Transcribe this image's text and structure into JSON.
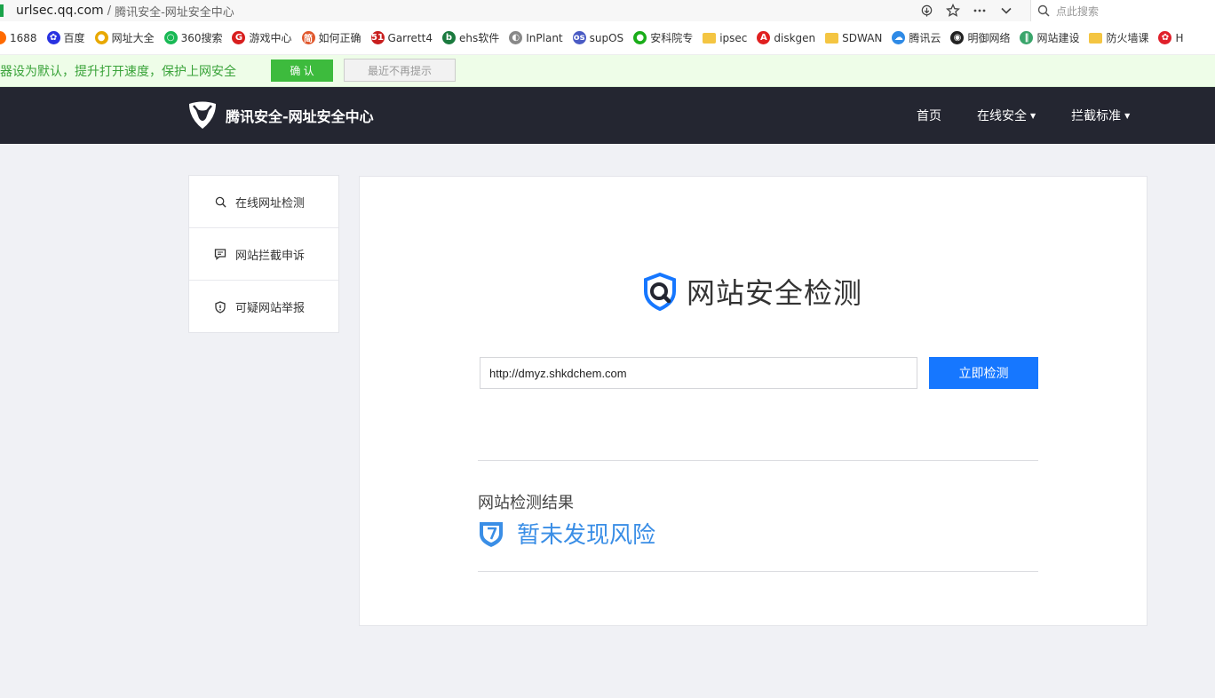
{
  "browser": {
    "url_host": "urlsec.qq.com",
    "url_sep": "/",
    "page_title": "腾讯安全-网址安全中心",
    "search_placeholder": "点此搜索"
  },
  "bookmarks": [
    {
      "label": "1688",
      "icon": "1688-icon",
      "color": "#ff6a00"
    },
    {
      "label": "百度",
      "icon": "baidu-paw-icon",
      "color": "#2932e1"
    },
    {
      "label": "网址大全",
      "icon": "hao123-icon",
      "color": "#e8a800"
    },
    {
      "label": "360搜索",
      "icon": "360-icon",
      "color": "#19b955"
    },
    {
      "label": "游戏中心",
      "icon": "game-icon",
      "color": "#d81e1e"
    },
    {
      "label": "如何正确",
      "icon": "jian-icon",
      "color": "#e0572c"
    },
    {
      "label": "Garrett4",
      "icon": "51-icon",
      "color": "#c81e1e"
    },
    {
      "label": "ehs软件",
      "icon": "b-icon",
      "color": "#1a7a3e"
    },
    {
      "label": "InPlant",
      "icon": "globe-icon",
      "color": "#888888"
    },
    {
      "label": "supOS",
      "icon": "os-icon",
      "color": "#4a5bc4"
    },
    {
      "label": "安科院专",
      "icon": "wechat-icon",
      "color": "#1aad19"
    },
    {
      "label": "ipsec",
      "icon": "folder-icon",
      "color": "#f4c542"
    },
    {
      "label": "diskgen",
      "icon": "acrobat-icon",
      "color": "#e02020"
    },
    {
      "label": "SDWAN",
      "icon": "folder-icon",
      "color": "#f4c542"
    },
    {
      "label": "腾讯云",
      "icon": "cloud-icon",
      "color": "#2e8ae6"
    },
    {
      "label": "明御网络",
      "icon": "globe-dark-icon",
      "color": "#222222"
    },
    {
      "label": "网站建设",
      "icon": "bars-icon",
      "color": "#3aa56b"
    },
    {
      "label": "防火墙课",
      "icon": "folder-icon",
      "color": "#f4c542"
    },
    {
      "label": "H",
      "icon": "huawei-icon",
      "color": "#e0202b"
    }
  ],
  "notify": {
    "text": "器设为默认，提升打开速度，保护上网安全",
    "confirm_label": "确 认",
    "dismiss_label": "最近不再提示"
  },
  "header": {
    "logo_text": "腾讯安全-网址安全中心",
    "nav": {
      "home": "首页",
      "online_security": "在线安全",
      "block_standard": "拦截标准"
    }
  },
  "sidebar": {
    "items": [
      {
        "label": "在线网址检测",
        "icon": "search-icon"
      },
      {
        "label": "网站拦截申诉",
        "icon": "chat-icon"
      },
      {
        "label": "可疑网站举报",
        "icon": "shield-alert-icon"
      }
    ]
  },
  "main": {
    "hero_title": "网站安全检测",
    "input_value": "http://dmyz.shkdchem.com",
    "check_button": "立即检测",
    "result_label": "网站检测结果",
    "result_text": "暂未发现风险"
  },
  "colors": {
    "header_bg": "#242631",
    "primary_blue": "#1677ff",
    "result_blue": "#3a8ee6",
    "notify_green": "#3dbb3d"
  }
}
